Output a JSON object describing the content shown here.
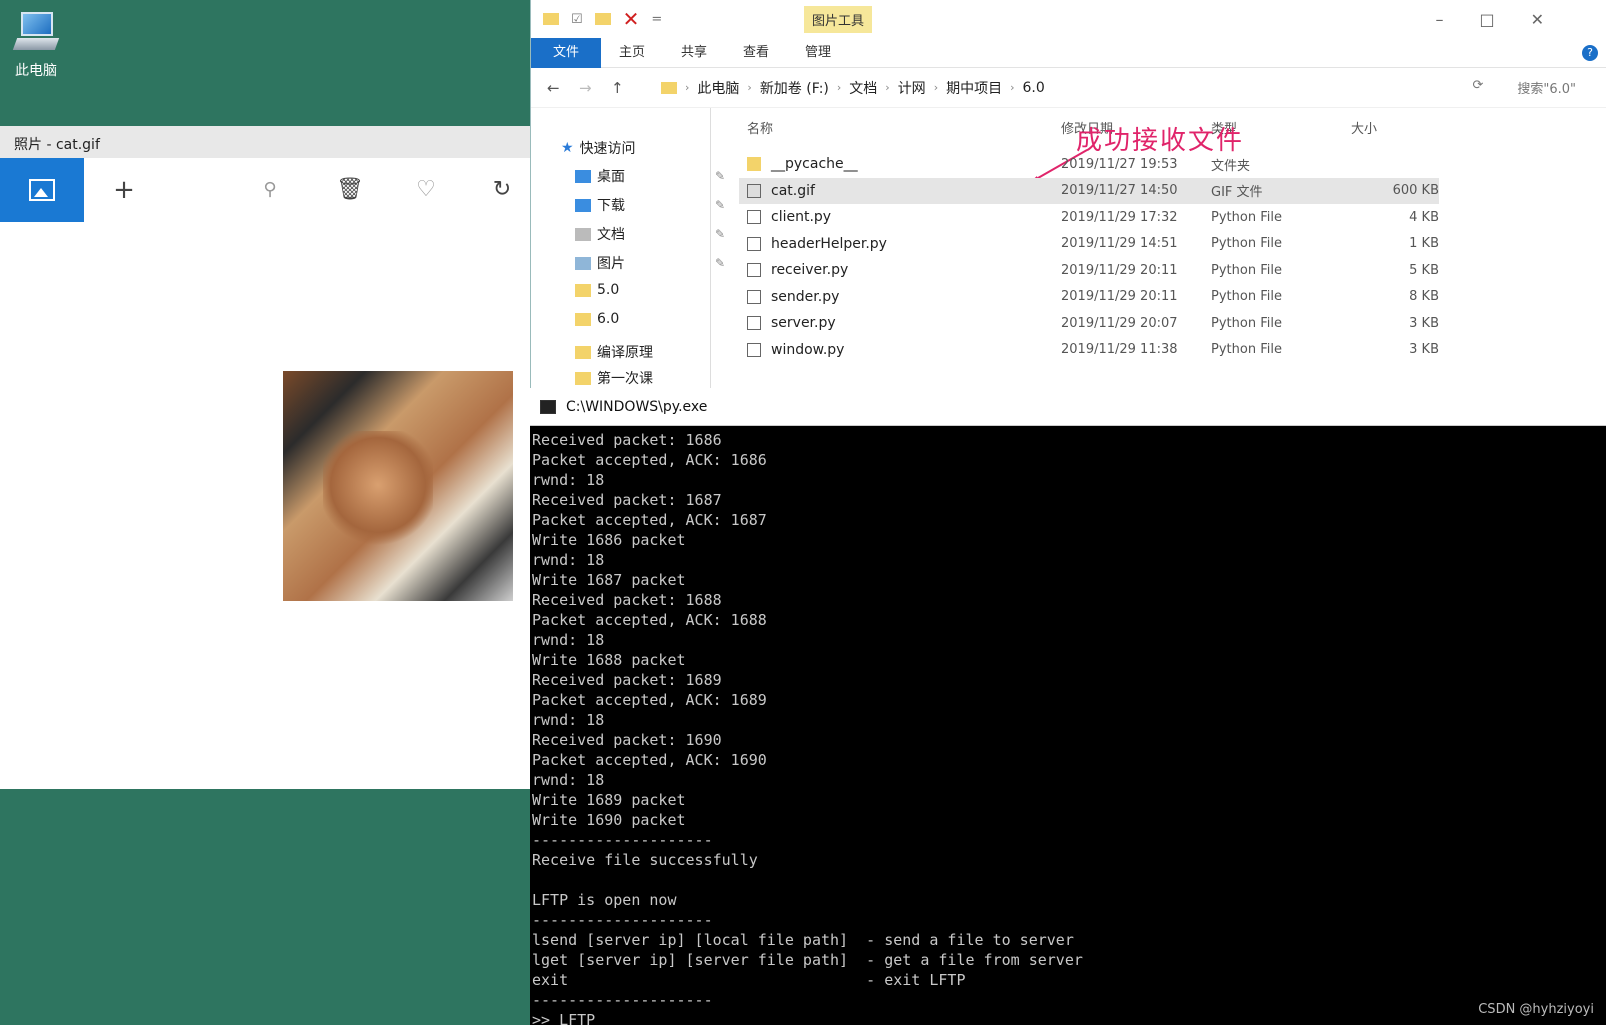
{
  "desktop": {
    "icon_label": "此电脑"
  },
  "photos": {
    "title": "照片 - cat.gif",
    "toolbar": [
      "add-icon",
      "zoom-icon",
      "delete-icon",
      "favorite-icon",
      "rotate-icon"
    ]
  },
  "explorer": {
    "context_tab": "图片工具",
    "ribbon_tabs": [
      "文件",
      "主页",
      "共享",
      "查看",
      "管理"
    ],
    "breadcrumb": [
      "此电脑",
      "新加卷 (F:)",
      "文档",
      "计网",
      "期中项目",
      "6.0"
    ],
    "search_placeholder": "搜索\"6.0\"",
    "nav": {
      "quick_access": "快速访问",
      "items": [
        "桌面",
        "下载",
        "文档",
        "图片",
        "5.0",
        "6.0",
        "编译原理",
        "第一次课"
      ]
    },
    "columns": [
      "名称",
      "修改日期",
      "类型",
      "大小"
    ],
    "files": [
      {
        "name": "__pycache__",
        "date": "2019/11/27 19:53",
        "type": "文件夹",
        "size": "",
        "icon": "folder"
      },
      {
        "name": "cat.gif",
        "date": "2019/11/27 14:50",
        "type": "GIF 文件",
        "size": "600 KB",
        "icon": "gif"
      },
      {
        "name": "client.py",
        "date": "2019/11/29 17:32",
        "type": "Python File",
        "size": "4 KB",
        "icon": "py"
      },
      {
        "name": "headerHelper.py",
        "date": "2019/11/29 14:51",
        "type": "Python File",
        "size": "1 KB",
        "icon": "py"
      },
      {
        "name": "receiver.py",
        "date": "2019/11/29 20:11",
        "type": "Python File",
        "size": "5 KB",
        "icon": "py"
      },
      {
        "name": "sender.py",
        "date": "2019/11/29 20:11",
        "type": "Python File",
        "size": "8 KB",
        "icon": "py"
      },
      {
        "name": "server.py",
        "date": "2019/11/29 20:07",
        "type": "Python File",
        "size": "3 KB",
        "icon": "py"
      },
      {
        "name": "window.py",
        "date": "2019/11/29 11:38",
        "type": "Python File",
        "size": "3 KB",
        "icon": "py"
      }
    ],
    "annotation": "成功接收文件"
  },
  "console": {
    "title": "C:\\WINDOWS\\py.exe",
    "lines": [
      "Received packet: 1686",
      "Packet accepted, ACK: 1686",
      "rwnd: 18",
      "Received packet: 1687",
      "Packet accepted, ACK: 1687",
      "Write 1686 packet",
      "rwnd: 18",
      "Write 1687 packet",
      "Received packet: 1688",
      "Packet accepted, ACK: 1688",
      "rwnd: 18",
      "Write 1688 packet",
      "Received packet: 1689",
      "Packet accepted, ACK: 1689",
      "rwnd: 18",
      "Received packet: 1690",
      "Packet accepted, ACK: 1690",
      "rwnd: 18",
      "Write 1689 packet",
      "Write 1690 packet",
      "--------------------",
      "Receive file successfully",
      "",
      "LFTP is open now",
      "--------------------",
      "lsend [server ip] [local file path]  - send a file to server",
      "lget [server ip] [server file path]  - get a file from server",
      "exit                                 - exit LFTP",
      "--------------------",
      ">> LFTP"
    ],
    "watermark": "CSDN @hyhziyoyi"
  }
}
